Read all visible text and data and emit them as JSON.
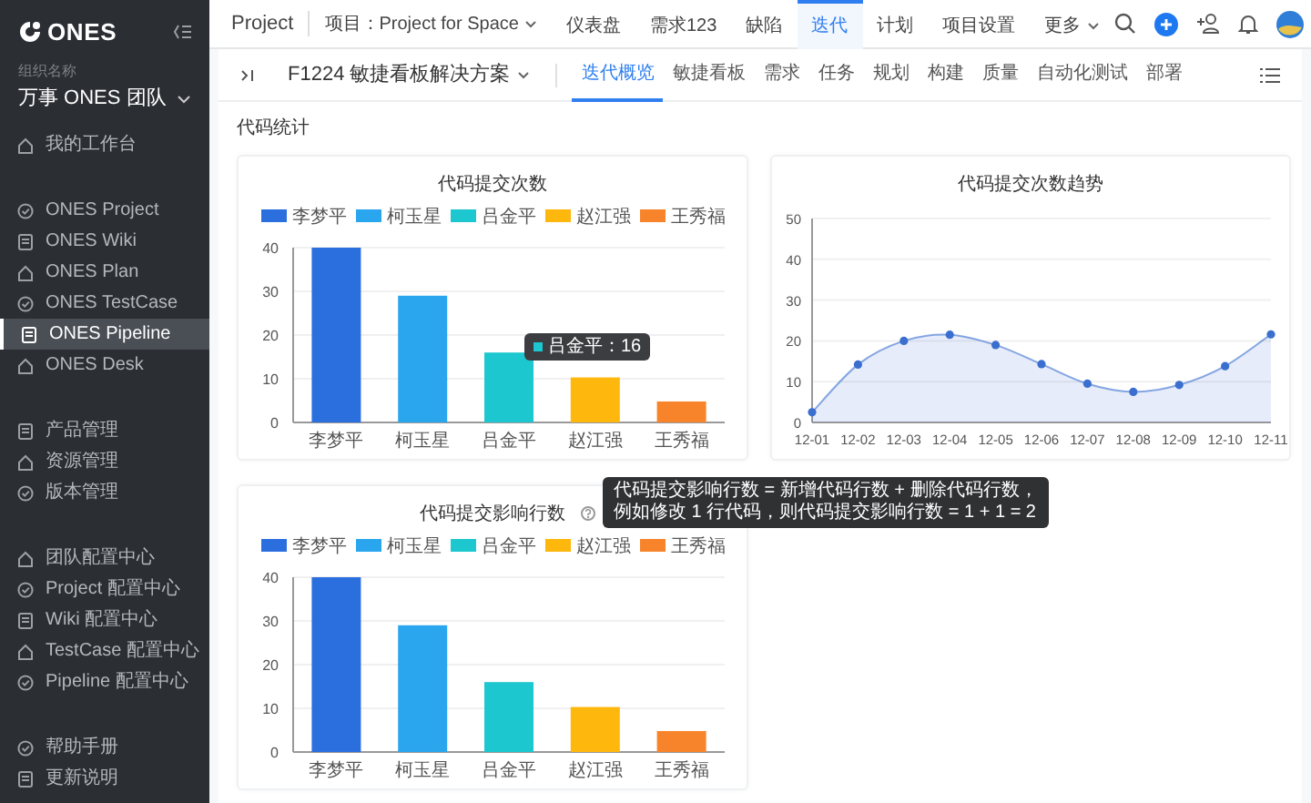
{
  "sidebar": {
    "logo": "ONES",
    "org_label": "组织名称",
    "org_name": "万事 ONES 团队",
    "groups": [
      [
        {
          "label": "我的工作台",
          "selected": false
        }
      ],
      [
        {
          "label": "ONES Project",
          "selected": false
        },
        {
          "label": "ONES Wiki",
          "selected": false
        },
        {
          "label": "ONES Plan",
          "selected": false
        },
        {
          "label": "ONES TestCase",
          "selected": false
        },
        {
          "label": "ONES Pipeline",
          "selected": true
        },
        {
          "label": "ONES Desk",
          "selected": false
        }
      ],
      [
        {
          "label": "产品管理",
          "selected": false
        },
        {
          "label": "资源管理",
          "selected": false
        },
        {
          "label": "版本管理",
          "selected": false
        }
      ],
      [
        {
          "label": "团队配置中心",
          "selected": false
        },
        {
          "label": "Project 配置中心",
          "selected": false
        },
        {
          "label": "Wiki 配置中心",
          "selected": false
        },
        {
          "label": "TestCase 配置中心",
          "selected": false
        },
        {
          "label": "Pipeline 配置中心",
          "selected": false
        }
      ],
      [
        {
          "label": "帮助手册",
          "selected": false
        },
        {
          "label": "更新说明",
          "selected": false
        }
      ]
    ]
  },
  "top_bar": {
    "app": "Project",
    "project_selector": "项目：Project for Space",
    "tabs": [
      {
        "label": "仪表盘",
        "selected": false
      },
      {
        "label": "需求123",
        "selected": false
      },
      {
        "label": "缺陷",
        "selected": false
      },
      {
        "label": "迭代",
        "selected": true
      },
      {
        "label": "计划",
        "selected": false
      },
      {
        "label": "项目设置",
        "selected": false
      },
      {
        "label": "更多",
        "selected": false,
        "kind": "menu"
      }
    ]
  },
  "sub_bar": {
    "sprint": "F1224 敏捷看板解决方案",
    "tabs": [
      {
        "label": "迭代概览",
        "selected": true
      },
      {
        "label": "敏捷看板",
        "selected": false
      },
      {
        "label": "需求",
        "selected": false
      },
      {
        "label": "任务",
        "selected": false
      },
      {
        "label": "规划",
        "selected": false
      },
      {
        "label": "构建",
        "selected": false
      },
      {
        "label": "质量",
        "selected": false
      },
      {
        "label": "自动化测试",
        "selected": false
      },
      {
        "label": "部署",
        "selected": false
      }
    ]
  },
  "section_title": "代码统计",
  "charts": [
    {
      "chart_data": {
        "type": "bar",
        "title": "代码提交次数",
        "categories": [
          "李梦平",
          "柯玉星",
          "吕金平",
          "赵江强",
          "王秀福"
        ],
        "grid": true,
        "yticks": [
          0,
          10,
          20,
          30,
          40
        ],
        "ylim": [
          0,
          40
        ],
        "series": [
          {
            "name": "李梦平",
            "color": "#2b6fdf",
            "values": [
              40,
              null,
              null,
              null,
              null
            ]
          },
          {
            "name": "柯玉星",
            "color": "#2aa6ee",
            "values": [
              null,
              29,
              null,
              null,
              null
            ]
          },
          {
            "name": "吕金平",
            "color": "#1cc7cf",
            "values": [
              null,
              null,
              16,
              null,
              null
            ]
          },
          {
            "name": "赵江强",
            "color": "#fdb70d",
            "values": [
              null,
              null,
              null,
              10.3,
              null
            ]
          },
          {
            "name": "王秀福",
            "color": "#f7842b",
            "values": [
              null,
              null,
              null,
              null,
              4.8
            ]
          }
        ]
      },
      "tooltip": {
        "text": "吕金平：16",
        "color": "#1cc7cf"
      }
    },
    {
      "chart_data": {
        "type": "area",
        "title": "代码提交次数趋势",
        "x": [
          "12-01",
          "12-02",
          "12-03",
          "12-04",
          "12-05",
          "12-06",
          "12-07",
          "12-08",
          "12-09",
          "12-10",
          "12-11"
        ],
        "ylim": [
          0,
          50
        ],
        "grid": true,
        "yticks": [
          0,
          10,
          20,
          30,
          40,
          50
        ],
        "series": [
          {
            "color": "#3a6fd0",
            "values": [
              2.5,
              14.2,
              20,
              21.5,
              19,
              14.3,
              9.5,
              7.5,
              9.2,
              13.8,
              21.6
            ]
          }
        ]
      }
    },
    {
      "chart_data": {
        "type": "bar",
        "title": "代码提交影响行数",
        "categories": [
          "李梦平",
          "柯玉星",
          "吕金平",
          "赵江强",
          "王秀福"
        ],
        "grid": true,
        "yticks": [
          0,
          10,
          20,
          30,
          40
        ],
        "ylim": [
          0,
          40
        ],
        "series": [
          {
            "name": "李梦平",
            "color": "#2b6fdf",
            "values": [
              40,
              null,
              null,
              null,
              null
            ]
          },
          {
            "name": "柯玉星",
            "color": "#2aa6ee",
            "values": [
              null,
              29,
              null,
              null,
              null
            ]
          },
          {
            "name": "吕金平",
            "color": "#1cc7cf",
            "values": [
              null,
              null,
              16,
              null,
              null
            ]
          },
          {
            "name": "赵江强",
            "color": "#fdb70d",
            "values": [
              null,
              null,
              null,
              10.3,
              null
            ]
          },
          {
            "name": "王秀福",
            "color": "#f7842b",
            "values": [
              null,
              null,
              null,
              null,
              4.8
            ]
          }
        ]
      },
      "help_tooltip": [
        "代码提交影响行数 = 新增代码行数 + 删除代码行数，",
        "例如修改 1 行代码，则代码提交影响行数 = 1 + 1 = 2"
      ]
    }
  ]
}
